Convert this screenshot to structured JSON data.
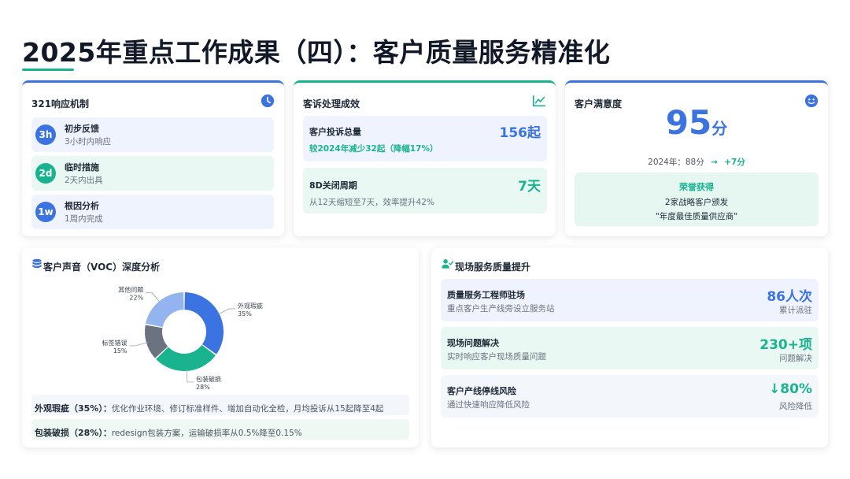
{
  "page": {
    "title": "2025年重点工作成果（四）：客户质量服务精准化"
  },
  "colors": {
    "blue": "#3b74e0",
    "green": "#19b38f",
    "gray": "#6b7280",
    "light_blue": "#93b4ee"
  },
  "response": {
    "title": "321响应机制",
    "icon": "clock-icon",
    "items": [
      {
        "badge": "3h",
        "name": "初步反馈",
        "desc": "3小时内响应"
      },
      {
        "badge": "2d",
        "name": "临时措施",
        "desc": "2天内出具"
      },
      {
        "badge": "1w",
        "name": "根因分析",
        "desc": "1周内完成"
      }
    ]
  },
  "complaints": {
    "title": "客诉处理成效",
    "icon": "line-chart-icon",
    "total_label": "客户投诉总量",
    "total_value": "156起",
    "total_note": "较2024年减少32起（降幅17%）",
    "close_label": "8D关闭周期",
    "close_value": "7天",
    "close_note": "从12天缩短至7天，效率提升42%"
  },
  "satisfaction": {
    "title": "客户满意度",
    "icon": "smile-icon",
    "score": "95",
    "unit": "分",
    "compare_prev": "2024年：88分",
    "compare_arrow": "→",
    "compare_delta": "+7分",
    "award_title": "荣誉获得",
    "award_line1": "2家战略客户颁发",
    "award_line2": "\"年度最佳质量供应商\""
  },
  "voc": {
    "title": "客户声音（VOC）深度分析",
    "icon": "database-icon",
    "rows": [
      {
        "key": "外观瑕疵（35%）：",
        "text": "优化作业环境、修订标准样件、增加自动化全检，月均投诉从15起降至4起"
      },
      {
        "key": "包装破损（28%）：",
        "text": "redesign包装方案，运输破损率从0.5%降至0.15%"
      }
    ]
  },
  "chart_data": {
    "type": "pie",
    "donut": true,
    "categories": [
      "外观瑕疵",
      "包装破损",
      "标签错误",
      "其他问题"
    ],
    "values": [
      35,
      28,
      15,
      22
    ],
    "labels": [
      "35%",
      "28%",
      "15%",
      "22%"
    ],
    "colors": [
      "#3b74e0",
      "#19b38f",
      "#6b7280",
      "#93b4ee"
    ]
  },
  "onsite": {
    "title": "现场服务质量提升",
    "icon": "user-check-icon",
    "rows": [
      {
        "name": "质量服务工程师驻场",
        "desc": "重点客户生产线旁设立服务站",
        "value": "86人次",
        "sub": "累计派驻"
      },
      {
        "name": "现场问题解决",
        "desc": "实时响应客户现场质量问题",
        "value": "230+项",
        "sub": "问题解决"
      },
      {
        "name": "客户产线停线风险",
        "desc": "通过快速响应降低风险",
        "value": "↓80%",
        "sub": "风险降低"
      }
    ]
  }
}
